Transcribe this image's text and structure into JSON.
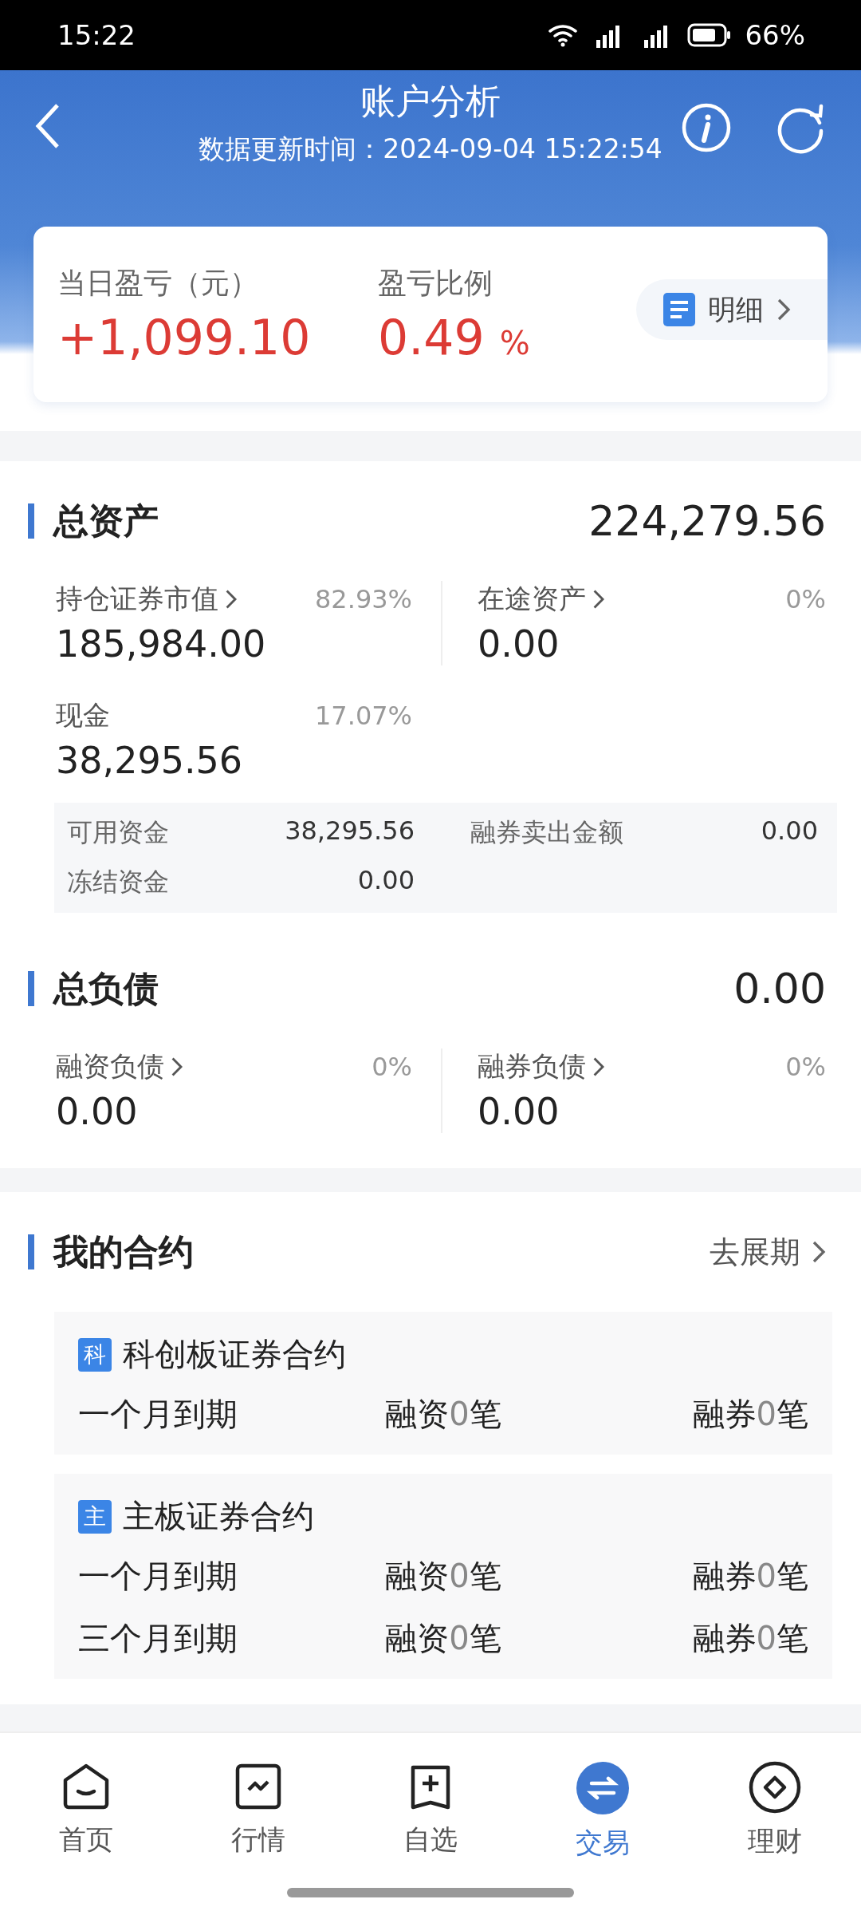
{
  "status_bar": {
    "time": "15:22",
    "battery": "66%"
  },
  "header": {
    "title": "账户分析",
    "subtitle": "数据更新时间：2024-09-04 15:22:54"
  },
  "pnl_card": {
    "items": [
      {
        "label": "当日盈亏（元）",
        "value": "+1,099.10"
      },
      {
        "label": "盈亏比例",
        "value": "0.49",
        "unit": "%"
      }
    ],
    "detail_button": "明细"
  },
  "assets": {
    "title": "总资产",
    "total": "224,279.56",
    "items": [
      {
        "label": "持仓证券市值",
        "percent": "82.93%",
        "value": "185,984.00",
        "has_arrow": true
      },
      {
        "label": "在途资产",
        "percent": "0%",
        "value": "0.00",
        "has_arrow": true
      },
      {
        "label": "现金",
        "percent": "17.07%",
        "value": "38,295.56",
        "has_arrow": false
      }
    ],
    "cash_details": [
      {
        "label": "可用资金",
        "value": "38,295.56"
      },
      {
        "label": "融券卖出金额",
        "value": "0.00"
      },
      {
        "label": "冻结资金",
        "value": "0.00"
      }
    ]
  },
  "liabilities": {
    "title": "总负债",
    "total": "0.00",
    "items": [
      {
        "label": "融资负债",
        "percent": "0%",
        "value": "0.00",
        "has_arrow": true
      },
      {
        "label": "融券负债",
        "percent": "0%",
        "value": "0.00",
        "has_arrow": true
      }
    ]
  },
  "contracts": {
    "title": "我的合约",
    "action": "去展期",
    "groups": [
      {
        "badge": "科",
        "title": "科创板证券合约",
        "rows": [
          {
            "term": "一个月到期",
            "financing": {
              "label": "融资",
              "count": "0",
              "unit": "笔"
            },
            "lending": {
              "label": "融券",
              "count": "0",
              "unit": "笔"
            }
          }
        ]
      },
      {
        "badge": "主",
        "title": "主板证券合约",
        "rows": [
          {
            "term": "一个月到期",
            "financing": {
              "label": "融资",
              "count": "0",
              "unit": "笔"
            },
            "lending": {
              "label": "融券",
              "count": "0",
              "unit": "笔"
            }
          },
          {
            "term": "三个月到期",
            "financing": {
              "label": "融资",
              "count": "0",
              "unit": "笔"
            },
            "lending": {
              "label": "融券",
              "count": "0",
              "unit": "笔"
            }
          }
        ]
      }
    ]
  },
  "nav": [
    {
      "kind": "home",
      "label": "首页",
      "selected": false
    },
    {
      "kind": "market",
      "label": "行情",
      "selected": false
    },
    {
      "kind": "watchlist",
      "label": "自选",
      "selected": false
    },
    {
      "kind": "trade",
      "label": "交易",
      "selected": true
    },
    {
      "kind": "wealth",
      "label": "理财",
      "selected": false
    }
  ]
}
